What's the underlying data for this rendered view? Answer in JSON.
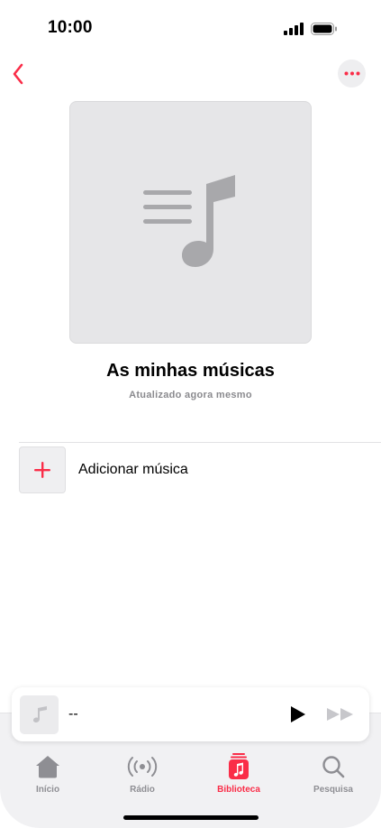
{
  "status_bar": {
    "time": "10:00"
  },
  "navigation": {
    "back_icon": "chevron-left-icon",
    "more_icon": "ellipsis-icon"
  },
  "playlist": {
    "title": "As minhas músicas",
    "subtitle": "Atualizado agora mesmo",
    "artwork_icon": "music-note-list-icon"
  },
  "actions": {
    "add_music_label": "Adicionar música",
    "add_icon": "plus-icon"
  },
  "mini_player": {
    "track_title": "--",
    "play_icon": "play-icon",
    "next_icon": "forward-icon"
  },
  "tabs": [
    {
      "label": "Início",
      "icon": "home-icon",
      "active": false
    },
    {
      "label": "Rádio",
      "icon": "radio-icon",
      "active": false
    },
    {
      "label": "Biblioteca",
      "icon": "library-icon",
      "active": true
    },
    {
      "label": "Pesquisa",
      "icon": "search-icon",
      "active": false
    }
  ],
  "colors": {
    "accent": "#fa2d48",
    "inactive": "#8e8e93",
    "artwork_bg": "#e6e6e8"
  }
}
